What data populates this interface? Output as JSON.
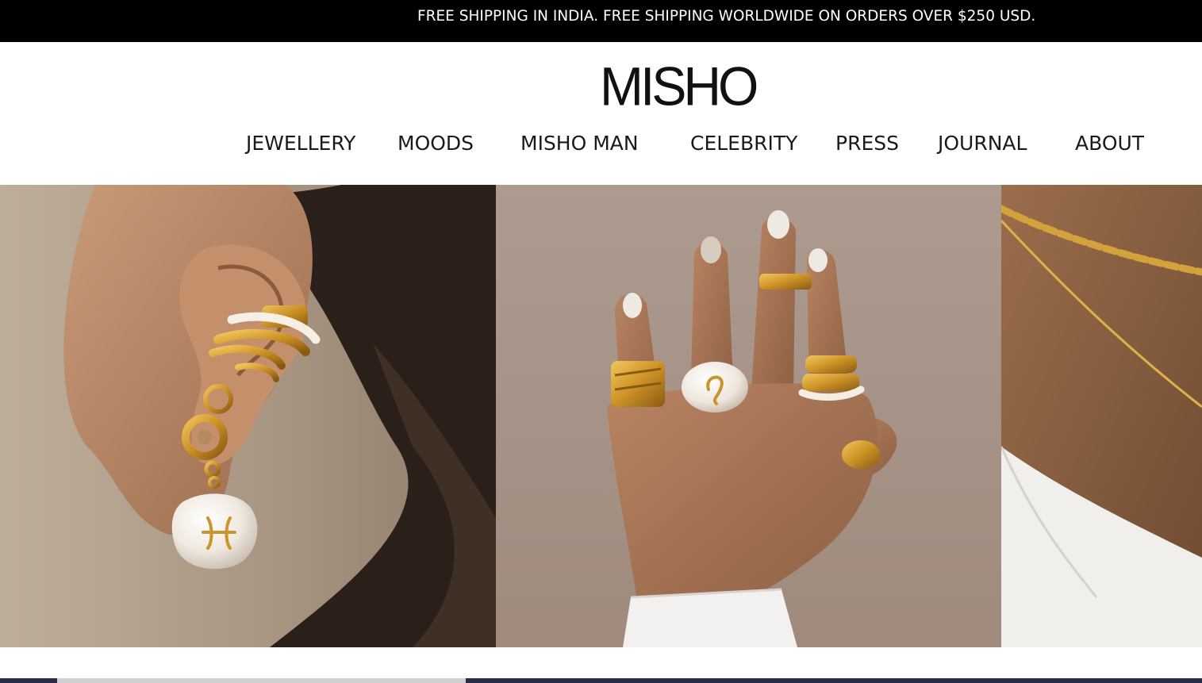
{
  "announcement": {
    "text": "FREE SHIPPING IN INDIA. FREE SHIPPING WORLDWIDE ON ORDERS OVER $250 USD."
  },
  "header": {
    "logo": "MISHO"
  },
  "nav": {
    "items": [
      {
        "label": "JEWELLERY"
      },
      {
        "label": "MOODS"
      },
      {
        "label": "MISHO MAN"
      },
      {
        "label": "CELEBRITY"
      },
      {
        "label": "PRESS"
      },
      {
        "label": "JOURNAL"
      },
      {
        "label": "ABOUT"
      }
    ]
  },
  "hero": {
    "panels": [
      {
        "subject": "ear-cuffs-and-pearl-earring"
      },
      {
        "subject": "hand-with-gold-rings"
      },
      {
        "subject": "neck-with-gold-chains"
      }
    ]
  },
  "colors": {
    "announcement_bg": "#000000",
    "announcement_text": "#ffffff",
    "gold": "#c9962e",
    "pearl": "#f3ede4"
  }
}
